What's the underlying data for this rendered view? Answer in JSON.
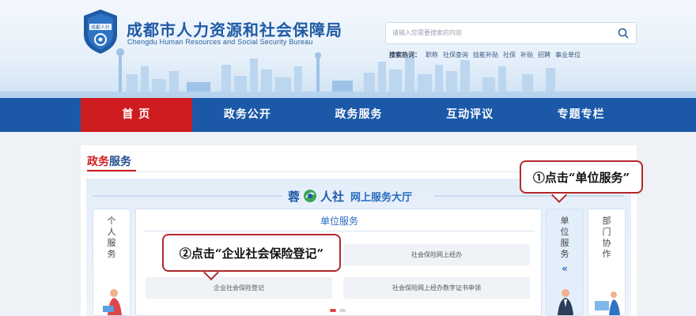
{
  "header": {
    "title_cn": "成都市人力资源和社会保障局",
    "title_en": "Chengdu Human Resources and Social Security Bureau",
    "logo_text": "成都人社"
  },
  "search": {
    "placeholder": "请输入您需要搜索的内容",
    "hot_label": "搜索热词：",
    "hot_words": [
      "职称",
      "社保查询",
      "技能补贴",
      "社保",
      "补贴",
      "招聘",
      "事业单位"
    ]
  },
  "nav": {
    "items": [
      "首 页",
      "政务公开",
      "政务服务",
      "互动评议",
      "专题专栏"
    ],
    "active_index": 0
  },
  "section": {
    "title_red": "政务",
    "title_blue": "服务"
  },
  "hall": {
    "brand_a": "蓉",
    "brand_b": "人社",
    "subtitle": "网上服务大厅"
  },
  "sidebar": {
    "left": "个人服务",
    "right_active": "单位服务",
    "right_other": "部门协作",
    "arrow": "«"
  },
  "center": {
    "heading": "单位服务",
    "services": [
      "社会保险网上经办",
      "企业社会保险登记",
      "社会保险网上经办数字证书申领"
    ]
  },
  "callouts": {
    "step1": "①点击“单位服务”",
    "step2": "②点击“企业社会保险登记”"
  },
  "colors": {
    "nav_bg": "#1b59a8",
    "nav_active": "#cf1c21",
    "callout_border": "#b2282c"
  }
}
